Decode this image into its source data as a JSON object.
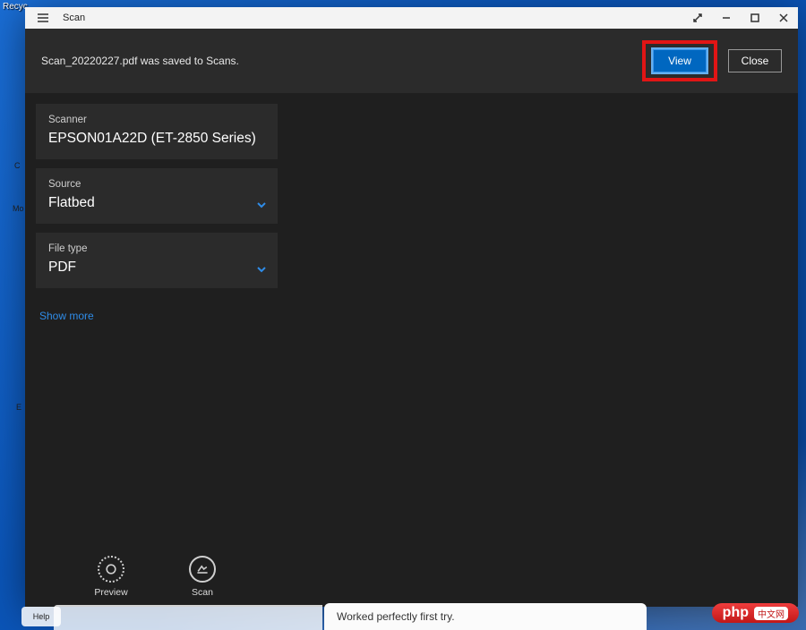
{
  "desktop": {
    "recycle": "Recyc..."
  },
  "titlebar": {
    "title": "Scan"
  },
  "notification": {
    "message": "Scan_20220227.pdf was saved to Scans.",
    "view": "View",
    "close": "Close"
  },
  "sidebar": {
    "scanner": {
      "label": "Scanner",
      "value": "EPSON01A22D (ET-2850 Series)"
    },
    "source": {
      "label": "Source",
      "value": "Flatbed"
    },
    "filetype": {
      "label": "File type",
      "value": "PDF"
    },
    "show_more": "Show more"
  },
  "bottom": {
    "preview": "Preview",
    "scan": "Scan"
  },
  "taskbar": {
    "help": "Help",
    "snippet": "Worked perfectly first try."
  },
  "badge": {
    "brand": "php",
    "cn": "中文网"
  },
  "behind": {
    "mo": "Mo"
  }
}
